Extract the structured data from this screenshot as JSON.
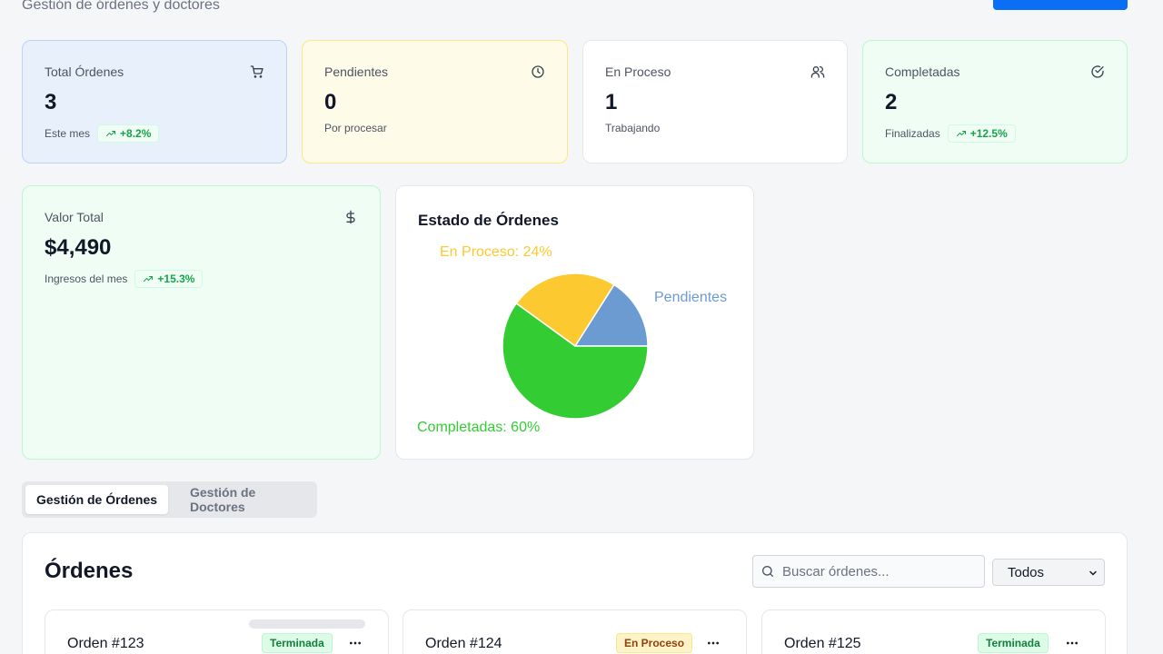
{
  "header": {
    "subtitle": "Gestión de órdenes y doctores"
  },
  "stats": [
    {
      "label": "Total Órdenes",
      "value": "3",
      "sub": "Este mes",
      "trend": "+8.2%",
      "icon": "cart-icon"
    },
    {
      "label": "Pendientes",
      "value": "0",
      "sub": "Por procesar",
      "icon": "clock-icon"
    },
    {
      "label": "En Proceso",
      "value": "1",
      "sub": "Trabajando",
      "icon": "users-icon"
    },
    {
      "label": "Completadas",
      "value": "2",
      "sub": "Finalizadas",
      "trend": "+12.5%",
      "icon": "check-circle-icon"
    }
  ],
  "valor": {
    "label": "Valor Total",
    "value": "$4,490",
    "sub": "Ingresos del mes",
    "trend": "+15.3%",
    "icon": "dollar-icon"
  },
  "chart_data": {
    "type": "pie",
    "title": "Estado de Órdenes",
    "slices": [
      {
        "name": "Pendientes",
        "value": 16,
        "color": "#6b9bd1",
        "label": "Pendientes"
      },
      {
        "name": "En Proceso",
        "value": 24,
        "color": "#fdc930",
        "label": "En Proceso: 24%"
      },
      {
        "name": "Completadas",
        "value": 60,
        "color": "#33cc33",
        "label": "Completadas: 60%"
      }
    ]
  },
  "tabs": [
    {
      "label": "Gestión de Órdenes",
      "active": true
    },
    {
      "label": "Gestión de Doctores",
      "active": false
    }
  ],
  "orders_panel": {
    "title": "Órdenes",
    "search_placeholder": "Buscar órdenes...",
    "filter_value": "Todos"
  },
  "orders": [
    {
      "title": "Orden #123",
      "status": "Terminada",
      "status_color": "green"
    },
    {
      "title": "Orden #124",
      "status": "En Proceso",
      "status_color": "yellow"
    },
    {
      "title": "Orden #125",
      "status": "Terminada",
      "status_color": "green"
    }
  ]
}
